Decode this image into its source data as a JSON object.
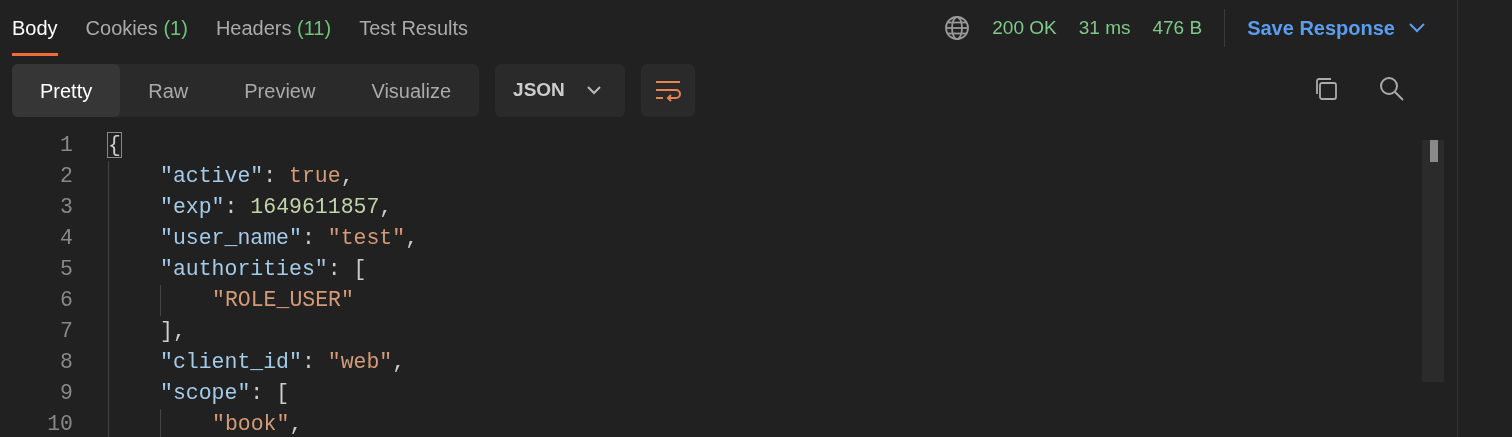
{
  "tabs": [
    {
      "label": "Body",
      "selected": true
    },
    {
      "label": "Cookies",
      "count": "(1)",
      "selected": false
    },
    {
      "label": "Headers",
      "count": "(11)",
      "selected": false
    },
    {
      "label": "Test Results",
      "selected": false
    }
  ],
  "status": {
    "code": "200 OK",
    "time": "31 ms",
    "size": "476 B"
  },
  "save_button": "Save Response",
  "views": [
    {
      "label": "Pretty",
      "selected": true
    },
    {
      "label": "Raw",
      "selected": false
    },
    {
      "label": "Preview",
      "selected": false
    },
    {
      "label": "Visualize",
      "selected": false
    }
  ],
  "format": "JSON",
  "code": [
    {
      "number": "1",
      "tokens": [
        {
          "kind": "punct",
          "text": "{"
        }
      ],
      "children": [
        {
          "number": "2",
          "tokens": [
            {
              "kind": "key",
              "text": "\"active\""
            },
            {
              "kind": "punct",
              "text": ": "
            },
            {
              "kind": "bool",
              "text": "true"
            },
            {
              "kind": "punct",
              "text": ","
            }
          ]
        },
        {
          "number": "3",
          "tokens": [
            {
              "kind": "key",
              "text": "\"exp\""
            },
            {
              "kind": "punct",
              "text": ": "
            },
            {
              "kind": "number",
              "text": "1649611857"
            },
            {
              "kind": "punct",
              "text": ","
            }
          ]
        },
        {
          "number": "4",
          "tokens": [
            {
              "kind": "key",
              "text": "\"user_name\""
            },
            {
              "kind": "punct",
              "text": ": "
            },
            {
              "kind": "string",
              "text": "\"test\""
            },
            {
              "kind": "punct",
              "text": ","
            }
          ]
        },
        {
          "number": "5",
          "tokens": [
            {
              "kind": "key",
              "text": "\"authorities\""
            },
            {
              "kind": "punct",
              "text": ": ["
            }
          ],
          "children": [
            {
              "number": "6",
              "tokens": [
                {
                  "kind": "string",
                  "text": "\"ROLE_USER\""
                }
              ]
            }
          ]
        },
        {
          "number": "7",
          "tokens": [
            {
              "kind": "punct",
              "text": "],"
            }
          ]
        },
        {
          "number": "8",
          "tokens": [
            {
              "kind": "key",
              "text": "\"client_id\""
            },
            {
              "kind": "punct",
              "text": ": "
            },
            {
              "kind": "string",
              "text": "\"web\""
            },
            {
              "kind": "punct",
              "text": ","
            }
          ]
        },
        {
          "number": "9",
          "tokens": [
            {
              "kind": "key",
              "text": "\"scope\""
            },
            {
              "kind": "punct",
              "text": ": ["
            }
          ],
          "children": [
            {
              "number": "10",
              "tokens": [
                {
                  "kind": "string",
                  "text": "\"book\""
                },
                {
                  "kind": "punct",
                  "text": ","
                }
              ]
            }
          ]
        }
      ]
    }
  ]
}
